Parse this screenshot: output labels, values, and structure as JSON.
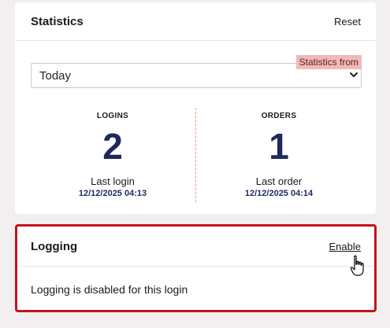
{
  "statistics": {
    "title": "Statistics",
    "reset_label": "Reset",
    "period_label": "Statistics from",
    "period_value": "Today",
    "logins": {
      "heading": "LOGINS",
      "value": "2",
      "label": "Last login",
      "date": "12/12/2025 04:13"
    },
    "orders": {
      "heading": "ORDERS",
      "value": "1",
      "label": "Last order",
      "date": "12/12/2025 04:14"
    }
  },
  "logging": {
    "title": "Logging",
    "enable_label": "Enable",
    "message": "Logging is disabled for this login"
  },
  "colors": {
    "accent_navy": "#1d2a5b",
    "highlight_red": "#c5141e",
    "label_pink": "#f1b9b7"
  },
  "icons": {
    "select_chevron": "chevron-down-icon",
    "mouse_cursor": "hand-pointer-cursor-icon"
  }
}
